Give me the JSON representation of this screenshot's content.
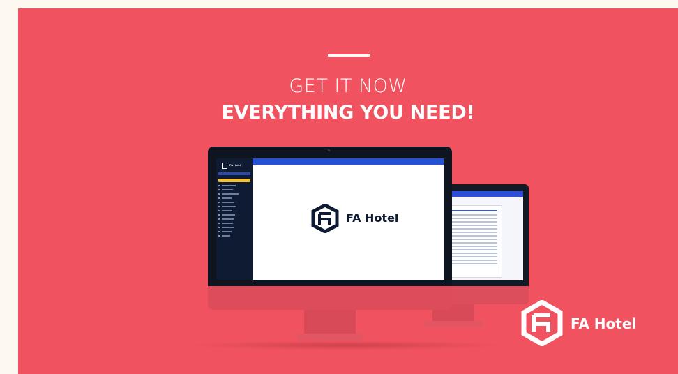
{
  "headline": {
    "small": "GET IT NOW",
    "big": "EVERYTHING YOU NEED!"
  },
  "screen": {
    "app_title": "FA Hotel",
    "center_logo_text": "FA Hotel"
  },
  "brand": {
    "name": "FA Hotel"
  },
  "colors": {
    "banner": "#f0535f",
    "page_background": "#fdf8f0",
    "sidebar": "#0f1b33",
    "topbar": "#2451d6",
    "sidebar_active": "#f5c137"
  },
  "icons": [
    "fa-hotel-logo-icon"
  ]
}
